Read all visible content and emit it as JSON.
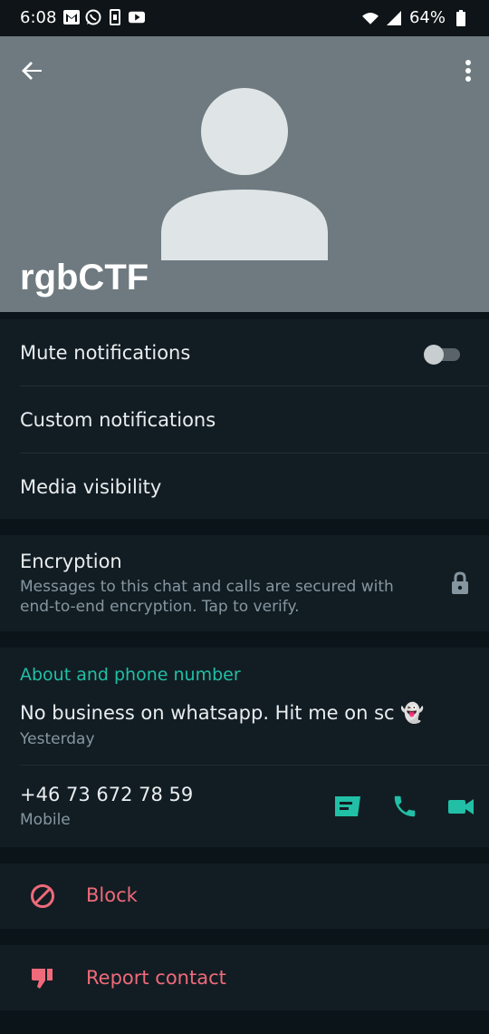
{
  "status_bar": {
    "time": "6:08",
    "battery": "64%",
    "icons": [
      "gmail-icon",
      "whatsapp-icon",
      "sim-icon",
      "youtube-icon",
      "wifi-icon",
      "signal-icon",
      "battery-icon"
    ]
  },
  "header": {
    "contact_name": "rgbCTF",
    "background": "#6e7a7f"
  },
  "settings": {
    "mute": "Mute notifications",
    "mute_enabled": false,
    "custom": "Custom notifications",
    "media": "Media visibility"
  },
  "encryption": {
    "title": "Encryption",
    "description": "Messages to this chat and calls are secured with end-to-end encryption. Tap to verify."
  },
  "about": {
    "heading": "About and phone number",
    "text": "No business on whatsapp. Hit me on sc 👻",
    "date": "Yesterday",
    "phone": "+46 73 672 78 59",
    "phone_type": "Mobile"
  },
  "actions": {
    "block": "Block",
    "report": "Report contact"
  },
  "colors": {
    "accent": "#21bfa6",
    "danger": "#ef6a7a",
    "surface": "#121d23",
    "background": "#0b1419"
  }
}
